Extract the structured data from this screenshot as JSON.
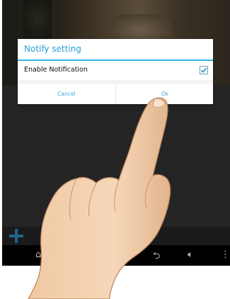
{
  "dialog": {
    "title": "Notify setting",
    "option_label": "Enable Notification",
    "option_checked": true,
    "cancel_label": "Cancel",
    "ok_label": "Ok"
  },
  "toolbar": {
    "add_icon": "plus-icon"
  },
  "navbar": {
    "icons": [
      "back-icon",
      "volume-icon",
      "overflow-menu-icon"
    ]
  },
  "colors": {
    "accent": "#33b5e5",
    "dialog_bg": "#ffffff",
    "navbar_bg": "#000000",
    "plus_icon": "#2e9ad6"
  }
}
